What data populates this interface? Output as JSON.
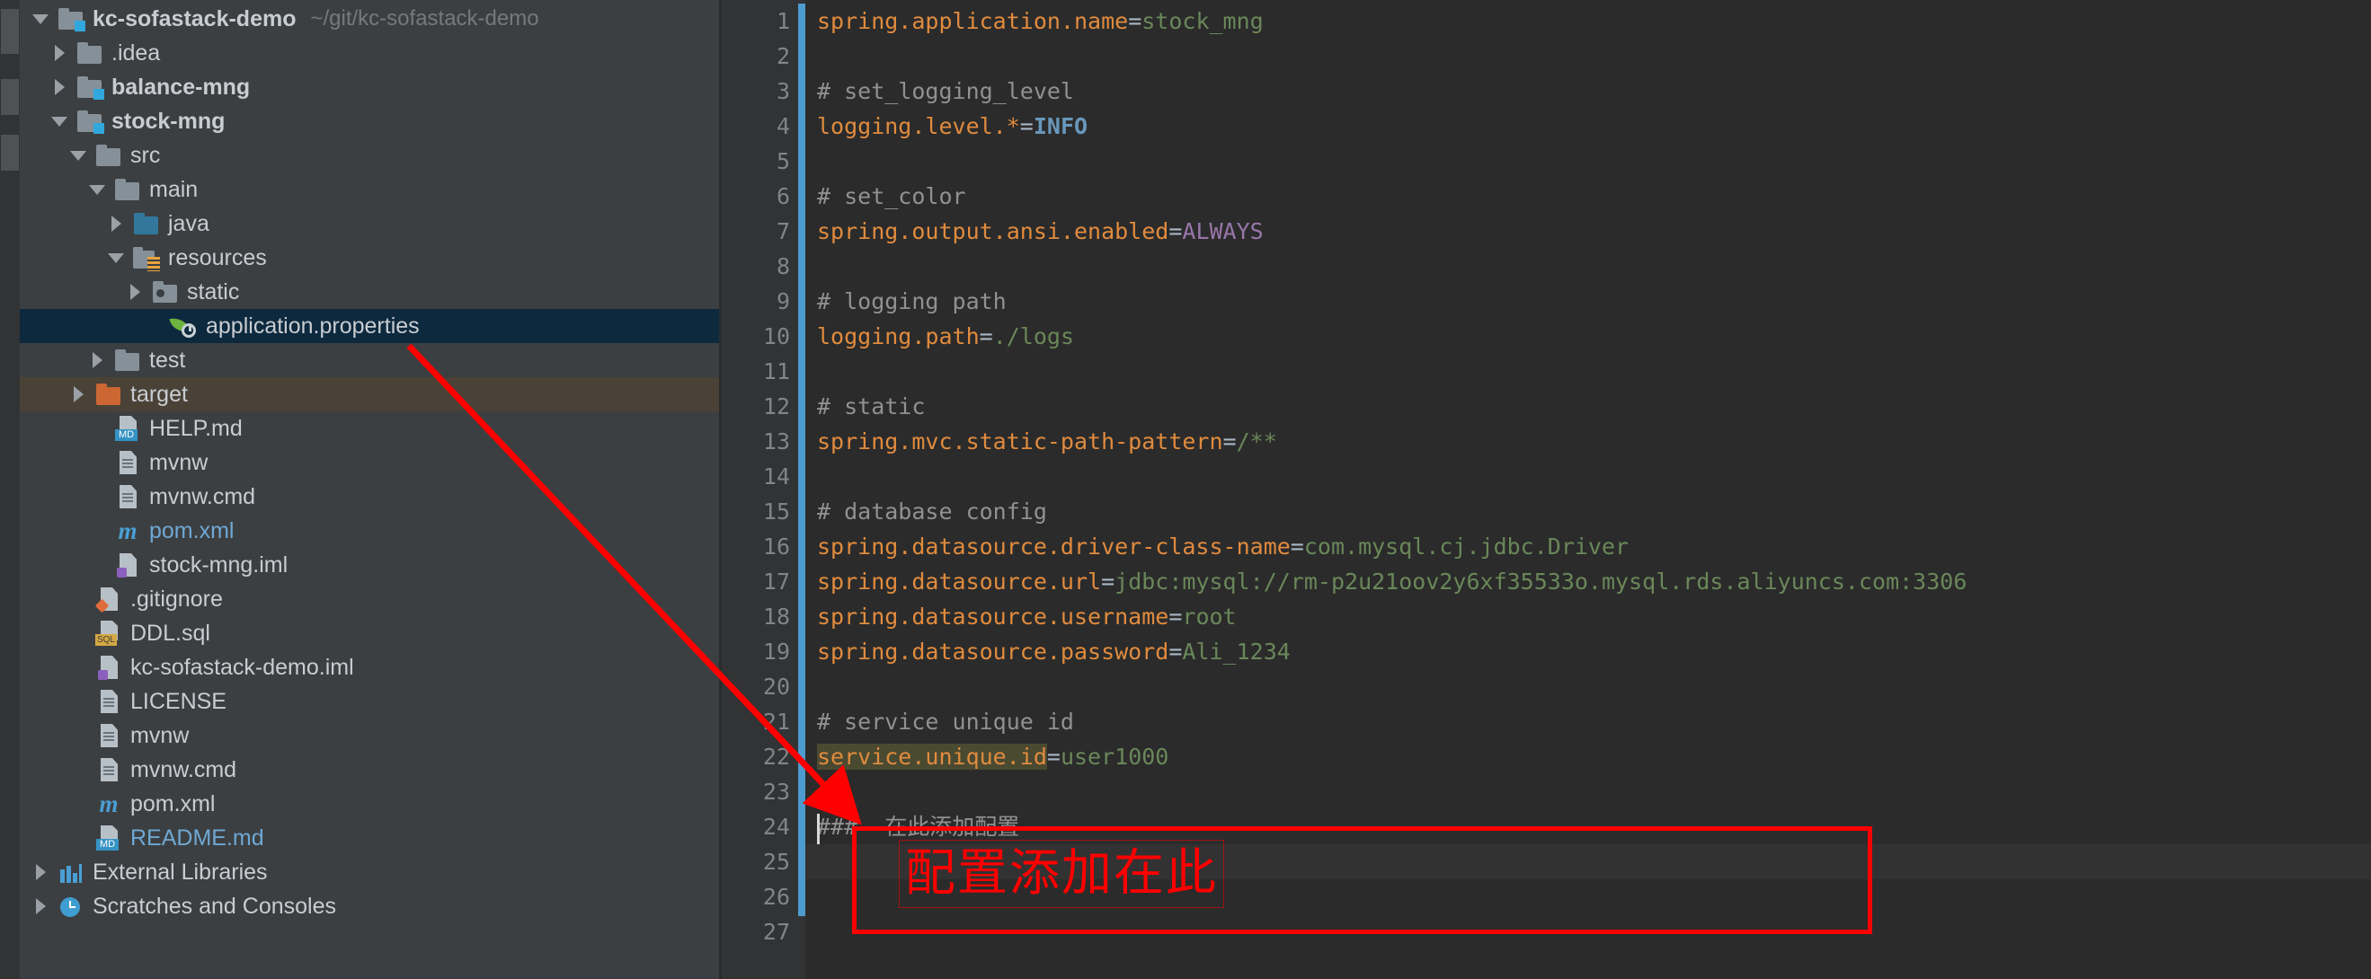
{
  "window": {
    "title": "kc-sofastack-demo",
    "project_path": "~/git/kc-sofastack-demo"
  },
  "sidebar": {
    "tree": [
      {
        "label": "kc-sofastack-demo",
        "suffix": "~/git/kc-sofastack-demo",
        "icon": "module-folder-icon",
        "arrow": "down",
        "indent": 0,
        "style": "bold",
        "selected": false
      },
      {
        "label": ".idea",
        "suffix": "",
        "icon": "folder-icon",
        "arrow": "right",
        "indent": 1,
        "style": "plain",
        "selected": false
      },
      {
        "label": "balance-mng",
        "suffix": "",
        "icon": "module-folder-icon",
        "arrow": "right",
        "indent": 1,
        "style": "bold",
        "selected": false
      },
      {
        "label": "stock-mng",
        "suffix": "",
        "icon": "module-folder-icon",
        "arrow": "down",
        "indent": 1,
        "style": "bold",
        "selected": false
      },
      {
        "label": "src",
        "suffix": "",
        "icon": "folder-icon",
        "arrow": "down",
        "indent": 2,
        "style": "plain",
        "selected": false
      },
      {
        "label": "main",
        "suffix": "",
        "icon": "folder-icon",
        "arrow": "down",
        "indent": 3,
        "style": "plain",
        "selected": false
      },
      {
        "label": "java",
        "suffix": "",
        "icon": "source-folder-icon",
        "arrow": "right",
        "indent": 4,
        "style": "plain",
        "selected": false
      },
      {
        "label": "resources",
        "suffix": "",
        "icon": "resources-folder-icon",
        "arrow": "down",
        "indent": 4,
        "style": "plain",
        "selected": false
      },
      {
        "label": "static",
        "suffix": "",
        "icon": "static-folder-icon",
        "arrow": "right",
        "indent": 5,
        "style": "plain",
        "selected": false
      },
      {
        "label": "application.properties",
        "suffix": "",
        "icon": "spring-boot-icon",
        "arrow": "none",
        "indent": 6,
        "style": "plain",
        "selected": true
      },
      {
        "label": "test",
        "suffix": "",
        "icon": "folder-icon",
        "arrow": "right",
        "indent": 3,
        "style": "plain",
        "selected": false
      },
      {
        "label": "target",
        "suffix": "",
        "icon": "target-folder-icon",
        "arrow": "right",
        "indent": 2,
        "style": "plain",
        "selected": false,
        "highlight": true
      },
      {
        "label": "HELP.md",
        "suffix": "",
        "icon": "markdown-file-icon",
        "arrow": "none",
        "indent": 3,
        "style": "plain",
        "selected": false
      },
      {
        "label": "mvnw",
        "suffix": "",
        "icon": "file-icon",
        "arrow": "none",
        "indent": 3,
        "style": "plain",
        "selected": false
      },
      {
        "label": "mvnw.cmd",
        "suffix": "",
        "icon": "file-icon",
        "arrow": "none",
        "indent": 3,
        "style": "plain",
        "selected": false
      },
      {
        "label": "pom.xml",
        "suffix": "",
        "icon": "maven-file-icon",
        "arrow": "none",
        "indent": 3,
        "style": "blue",
        "selected": false
      },
      {
        "label": "stock-mng.iml",
        "suffix": "",
        "icon": "iml-file-icon",
        "arrow": "none",
        "indent": 3,
        "style": "plain",
        "selected": false
      },
      {
        "label": ".gitignore",
        "suffix": "",
        "icon": "gitignore-file-icon",
        "arrow": "none",
        "indent": 2,
        "style": "plain",
        "selected": false
      },
      {
        "label": "DDL.sql",
        "suffix": "",
        "icon": "sql-file-icon",
        "arrow": "none",
        "indent": 2,
        "style": "plain",
        "selected": false
      },
      {
        "label": "kc-sofastack-demo.iml",
        "suffix": "",
        "icon": "iml-file-icon",
        "arrow": "none",
        "indent": 2,
        "style": "plain",
        "selected": false
      },
      {
        "label": "LICENSE",
        "suffix": "",
        "icon": "file-icon",
        "arrow": "none",
        "indent": 2,
        "style": "plain",
        "selected": false
      },
      {
        "label": "mvnw",
        "suffix": "",
        "icon": "file-icon",
        "arrow": "none",
        "indent": 2,
        "style": "plain",
        "selected": false
      },
      {
        "label": "mvnw.cmd",
        "suffix": "",
        "icon": "file-icon",
        "arrow": "none",
        "indent": 2,
        "style": "plain",
        "selected": false
      },
      {
        "label": "pom.xml",
        "suffix": "",
        "icon": "maven-file-icon",
        "arrow": "none",
        "indent": 2,
        "style": "plain",
        "selected": false
      },
      {
        "label": "README.md",
        "suffix": "",
        "icon": "markdown-file-icon",
        "arrow": "none",
        "indent": 2,
        "style": "blue",
        "selected": false
      },
      {
        "label": "External Libraries",
        "suffix": "",
        "icon": "external-libraries-icon",
        "arrow": "right",
        "indent": 0,
        "style": "plain",
        "selected": false
      },
      {
        "label": "Scratches and Consoles",
        "suffix": "",
        "icon": "scratches-icon",
        "arrow": "right",
        "indent": 0,
        "style": "plain",
        "selected": false
      }
    ]
  },
  "editor": {
    "filename": "application.properties",
    "line_numbers": [
      "1",
      "2",
      "3",
      "4",
      "5",
      "6",
      "7",
      "8",
      "9",
      "10",
      "11",
      "12",
      "13",
      "14",
      "15",
      "16",
      "17",
      "18",
      "19",
      "20",
      "21",
      "22",
      "23",
      "24",
      "25",
      "26",
      "27"
    ],
    "lines": [
      {
        "n": 1,
        "segs": [
          {
            "t": "spring.application.name",
            "c": "k"
          },
          {
            "t": "=",
            "c": "eq"
          },
          {
            "t": "stock_mng",
            "c": "v"
          }
        ]
      },
      {
        "n": 2,
        "segs": []
      },
      {
        "n": 3,
        "segs": [
          {
            "t": "# set_logging_level",
            "c": "cm"
          }
        ]
      },
      {
        "n": 4,
        "segs": [
          {
            "t": "logging.level.*",
            "c": "k"
          },
          {
            "t": "=",
            "c": "eq"
          },
          {
            "t": "INFO",
            "c": "vb"
          }
        ]
      },
      {
        "n": 5,
        "segs": []
      },
      {
        "n": 6,
        "segs": [
          {
            "t": "# set_color",
            "c": "cm"
          }
        ]
      },
      {
        "n": 7,
        "segs": [
          {
            "t": "spring.output.ansi.enabled",
            "c": "k"
          },
          {
            "t": "=",
            "c": "eq"
          },
          {
            "t": "ALWAYS",
            "c": "vp"
          }
        ]
      },
      {
        "n": 8,
        "segs": []
      },
      {
        "n": 9,
        "segs": [
          {
            "t": "# logging path",
            "c": "cm"
          }
        ]
      },
      {
        "n": 10,
        "segs": [
          {
            "t": "logging.path",
            "c": "k"
          },
          {
            "t": "=",
            "c": "eq"
          },
          {
            "t": "./logs",
            "c": "v"
          }
        ]
      },
      {
        "n": 11,
        "segs": []
      },
      {
        "n": 12,
        "segs": [
          {
            "t": "# static",
            "c": "cm"
          }
        ]
      },
      {
        "n": 13,
        "segs": [
          {
            "t": "spring.mvc.static-path-pattern",
            "c": "k"
          },
          {
            "t": "=",
            "c": "eq"
          },
          {
            "t": "/**",
            "c": "v"
          }
        ]
      },
      {
        "n": 14,
        "segs": []
      },
      {
        "n": 15,
        "segs": [
          {
            "t": "# database config",
            "c": "cm"
          }
        ]
      },
      {
        "n": 16,
        "segs": [
          {
            "t": "spring.datasource.driver-class-name",
            "c": "k"
          },
          {
            "t": "=",
            "c": "eq"
          },
          {
            "t": "com.mysql.cj.jdbc.Driver",
            "c": "v"
          }
        ]
      },
      {
        "n": 17,
        "segs": [
          {
            "t": "spring.datasource.url",
            "c": "k"
          },
          {
            "t": "=",
            "c": "eq"
          },
          {
            "t": "jdbc:mysql://rm-p2u21oov2y6xf35533o.mysql.rds.aliyuncs.com:3306",
            "c": "v"
          }
        ]
      },
      {
        "n": 18,
        "segs": [
          {
            "t": "spring.datasource.username",
            "c": "k"
          },
          {
            "t": "=",
            "c": "eq"
          },
          {
            "t": "root",
            "c": "v"
          }
        ]
      },
      {
        "n": 19,
        "segs": [
          {
            "t": "spring.datasource.password",
            "c": "k"
          },
          {
            "t": "=",
            "c": "eq"
          },
          {
            "t": "Ali_1234",
            "c": "v"
          }
        ]
      },
      {
        "n": 20,
        "segs": []
      },
      {
        "n": 21,
        "segs": [
          {
            "t": "# service unique id",
            "c": "cm"
          }
        ]
      },
      {
        "n": 22,
        "segs": [
          {
            "t": "service.unique.id",
            "c": "k hl"
          },
          {
            "t": "=",
            "c": "eq"
          },
          {
            "t": "user1000",
            "c": "v"
          }
        ]
      },
      {
        "n": 23,
        "segs": []
      },
      {
        "n": 24,
        "segs": [
          {
            "t": "###  在此添加配置",
            "c": "cm"
          }
        ]
      },
      {
        "n": 25,
        "segs": []
      },
      {
        "n": 26,
        "segs": []
      },
      {
        "n": 27,
        "segs": []
      }
    ]
  },
  "annotations": {
    "callout_text": "配置添加在此",
    "arrow_color": "#ff0000",
    "box_color": "#ff0000"
  }
}
